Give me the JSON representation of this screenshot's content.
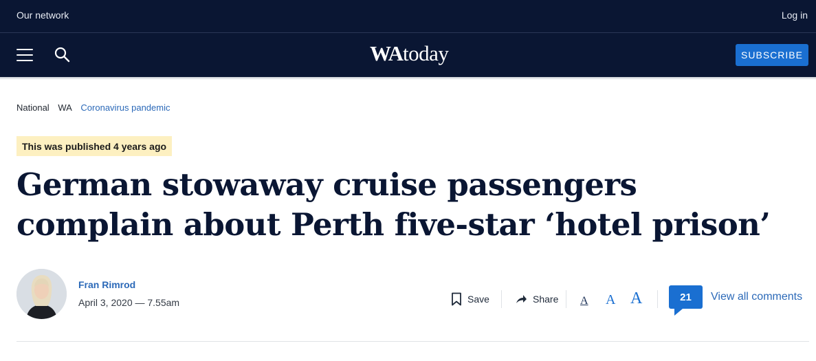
{
  "topbar": {
    "network_label": "Our network",
    "login_label": "Log in"
  },
  "header": {
    "logo": {
      "wa": "WA",
      "today": "today"
    },
    "subscribe_label": "SUBSCRIBE"
  },
  "breadcrumb": {
    "items": [
      "National",
      "WA",
      "Coronavirus pandemic"
    ]
  },
  "article": {
    "published_badge": "This was published 4 years ago",
    "headline": "German stowaway cruise passengers complain about Perth five-star ‘hotel prison’",
    "author": "Fran Rimrod",
    "date": "April 3, 2020 — 7.55am"
  },
  "tools": {
    "save_label": "Save",
    "share_label": "Share",
    "font_sizes": [
      "A",
      "A",
      "A"
    ],
    "comment_count": "21",
    "view_comments_label": "View all comments"
  },
  "colors": {
    "navy": "#0a1633",
    "accent_blue": "#1a6fd1",
    "link_blue": "#2b69b8",
    "badge_yellow": "#fdf0c1"
  }
}
